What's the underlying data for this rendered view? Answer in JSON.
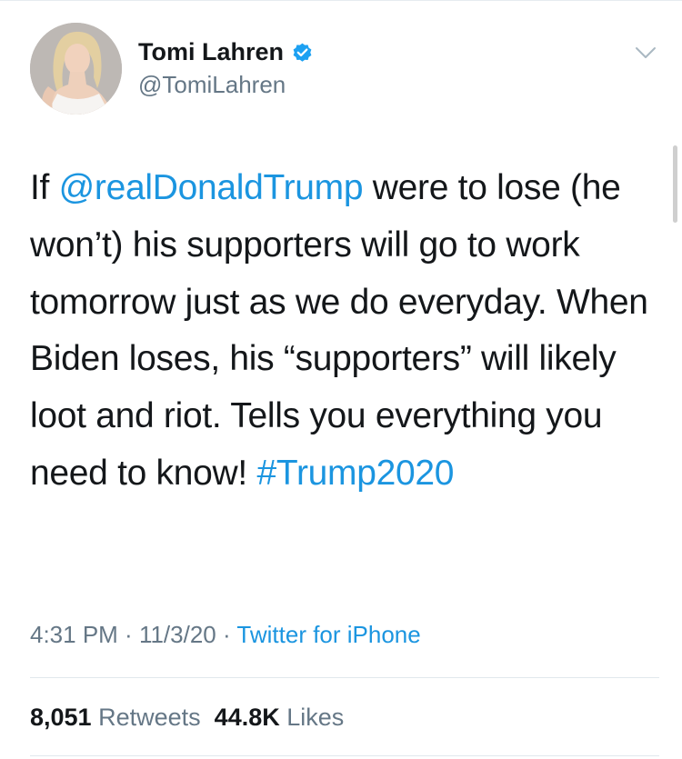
{
  "author": {
    "display_name": "Tomi Lahren",
    "handle": "@TomiLahren",
    "verified_icon": "verified-badge-icon",
    "avatar_icon": "profile-photo"
  },
  "tweet": {
    "text_part1": "If ",
    "mention": "@realDonaldTrump",
    "text_part2": " were to lose (he won’t) his supporters will go to work tomorrow just as we do everyday. When Biden loses, his “supporters” will likely loot and riot. Tells you everything you need to know! ",
    "hashtag": "#Trump2020"
  },
  "meta": {
    "time": "4:31 PM",
    "separator1": " · ",
    "date": "11/3/20",
    "separator2": " · ",
    "source": "Twitter for iPhone"
  },
  "stats": {
    "retweets_count": "8,051",
    "retweets_label": "Retweets",
    "likes_count": "44.8K",
    "likes_label": "Likes"
  },
  "colors": {
    "link": "#1b95e0",
    "secondary_text": "#657786",
    "primary_text": "#14171a",
    "verified": "#1da1f2"
  },
  "icons": {
    "menu": "chevron-down-icon"
  }
}
